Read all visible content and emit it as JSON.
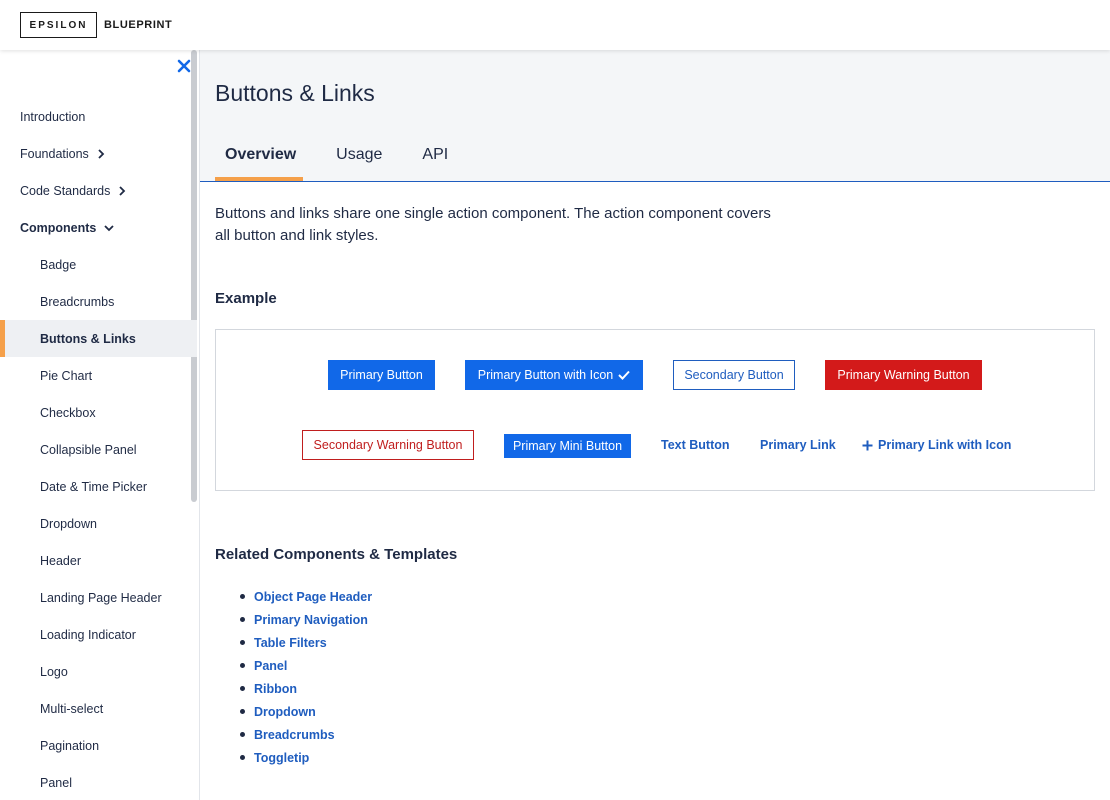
{
  "brand": {
    "logo_text": "EPSILON",
    "product": "BLUEPRINT"
  },
  "sidebar": {
    "items": [
      {
        "label": "Introduction"
      },
      {
        "label": "Foundations"
      },
      {
        "label": "Code Standards"
      },
      {
        "label": "Components"
      },
      {
        "label": "Badge"
      },
      {
        "label": "Breadcrumbs"
      },
      {
        "label": "Buttons & Links"
      },
      {
        "label": "Pie Chart"
      },
      {
        "label": "Checkbox"
      },
      {
        "label": "Collapsible Panel"
      },
      {
        "label": "Date & Time Picker"
      },
      {
        "label": "Dropdown"
      },
      {
        "label": "Header"
      },
      {
        "label": "Landing Page Header"
      },
      {
        "label": "Loading Indicator"
      },
      {
        "label": "Logo"
      },
      {
        "label": "Multi-select"
      },
      {
        "label": "Pagination"
      },
      {
        "label": "Panel"
      }
    ]
  },
  "page": {
    "title": "Buttons & Links",
    "tabs": [
      {
        "label": "Overview"
      },
      {
        "label": "Usage"
      },
      {
        "label": "API"
      }
    ],
    "intro": "Buttons and links share one single action component. The action component covers all button and link styles.",
    "example_heading": "Example",
    "related_heading": "Related Components & Templates"
  },
  "example": {
    "primary_button": "Primary Button",
    "primary_button_icon": "Primary Button with Icon",
    "secondary_button": "Secondary Button",
    "primary_warning_button": "Primary Warning Button",
    "secondary_warning_button": "Secondary Warning Button",
    "primary_mini_button": "Primary Mini Button",
    "text_button": "Text Button",
    "primary_link": "Primary Link",
    "primary_link_icon": "Primary Link with Icon"
  },
  "related": [
    {
      "label": "Object Page Header"
    },
    {
      "label": "Primary Navigation"
    },
    {
      "label": "Table Filters"
    },
    {
      "label": "Panel"
    },
    {
      "label": "Ribbon"
    },
    {
      "label": "Dropdown"
    },
    {
      "label": "Breadcrumbs"
    },
    {
      "label": "Toggletip"
    }
  ],
  "colors": {
    "primary": "#1168e8",
    "link": "#1f5dbf",
    "warning": "#d31a1a",
    "accent": "#f5a04a",
    "text": "#1f2a44"
  },
  "icons": [
    "close-icon",
    "chevron-right-icon",
    "chevron-down-icon",
    "check-icon",
    "plus-icon"
  ]
}
